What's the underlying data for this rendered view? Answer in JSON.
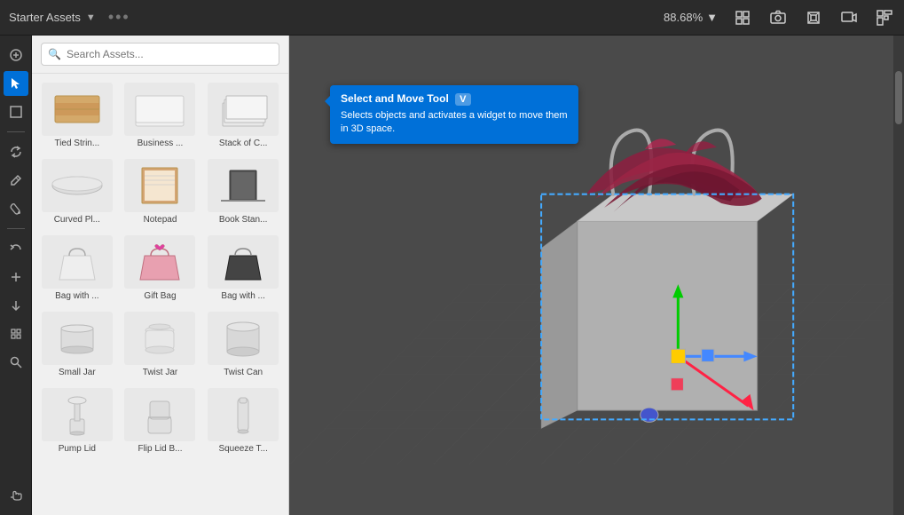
{
  "topbar": {
    "title": "Starter Assets",
    "zoom": "88.68%",
    "more_icon": "•••"
  },
  "toolbar": {
    "tools": [
      {
        "id": "add",
        "label": "+",
        "active": false
      },
      {
        "id": "select-move",
        "label": "↖",
        "active": true
      },
      {
        "id": "transform",
        "label": "⬛",
        "active": false
      },
      {
        "id": "rotate",
        "label": "↻",
        "active": false
      },
      {
        "id": "brush",
        "label": "✏",
        "active": false
      },
      {
        "id": "paint",
        "label": "🖌",
        "active": false
      },
      {
        "id": "undo",
        "label": "↩",
        "active": false
      },
      {
        "id": "plus2",
        "label": "+",
        "active": false
      },
      {
        "id": "down",
        "label": "↓",
        "active": false
      },
      {
        "id": "anchor",
        "label": "⚓",
        "active": false
      },
      {
        "id": "search2",
        "label": "🔍",
        "active": false
      },
      {
        "id": "hand",
        "label": "✋",
        "active": false
      }
    ]
  },
  "tooltip": {
    "title": "Select and Move Tool",
    "shortcut": "V",
    "description": "Selects objects and activates a widget to move them in 3D space."
  },
  "search": {
    "placeholder": "Search Assets...",
    "value": ""
  },
  "assets": [
    {
      "id": "tied-string",
      "label": "Tied Strin...",
      "shape": "box"
    },
    {
      "id": "business-card",
      "label": "Business ...",
      "shape": "paper"
    },
    {
      "id": "stack-of-cards",
      "label": "Stack of C...",
      "shape": "stack"
    },
    {
      "id": "curved-plate",
      "label": "Curved Pl...",
      "shape": "plate"
    },
    {
      "id": "notepad",
      "label": "Notepad",
      "shape": "notepad"
    },
    {
      "id": "book-stand",
      "label": "Book Stan...",
      "shape": "bookstand"
    },
    {
      "id": "bag-white",
      "label": "Bag with ...",
      "shape": "bag-white"
    },
    {
      "id": "gift-bag",
      "label": "Gift Bag",
      "shape": "bag-pink"
    },
    {
      "id": "bag-black",
      "label": "Bag with ...",
      "shape": "bag-black"
    },
    {
      "id": "small-jar",
      "label": "Small Jar",
      "shape": "jar-small"
    },
    {
      "id": "twist-jar",
      "label": "Twist Jar",
      "shape": "jar-twist"
    },
    {
      "id": "twist-can",
      "label": "Twist Can",
      "shape": "can-twist"
    },
    {
      "id": "pump-lid",
      "label": "Pump Lid",
      "shape": "pump"
    },
    {
      "id": "flip-lid",
      "label": "Flip Lid B...",
      "shape": "flip"
    },
    {
      "id": "squeeze-tube",
      "label": "Squeeze T...",
      "shape": "squeeze"
    }
  ],
  "viewport": {
    "background": "#4a4a4a",
    "grid_color": "#5a5a5a"
  }
}
